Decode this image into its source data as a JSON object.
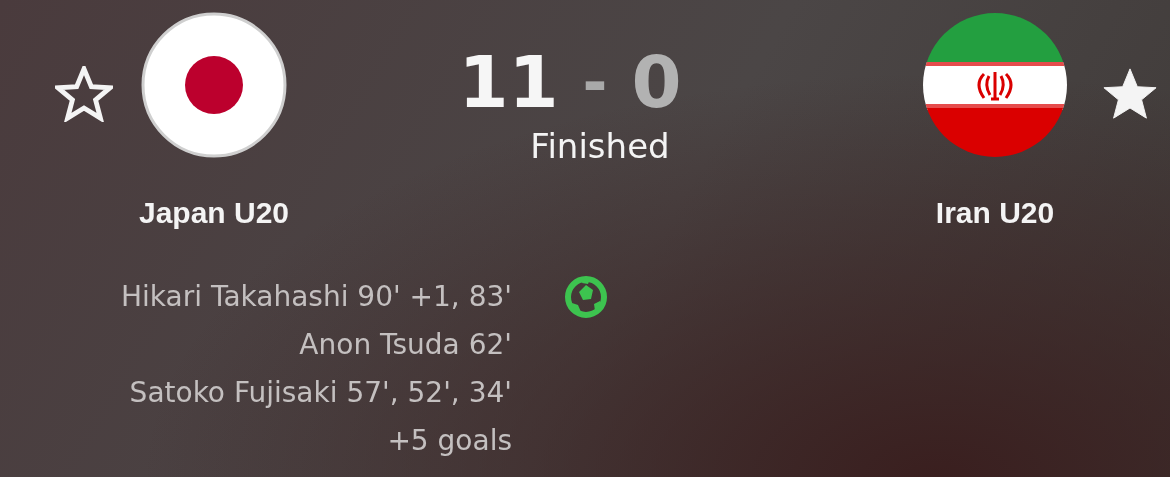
{
  "home": {
    "name": "Japan U20",
    "favorite": false,
    "kind": "japan",
    "winning": true
  },
  "away": {
    "name": "Iran U20",
    "favorite": true,
    "kind": "iran",
    "winning": false
  },
  "score": {
    "home": "11",
    "separator": "-",
    "away": "0"
  },
  "status": "Finished",
  "scorers": [
    "Hikari Takahashi 90' +1, 83'",
    "Anon Tsuda 62'",
    "Satoko Fujisaki 57', 52', 34'"
  ],
  "more_goals": "+5 goals"
}
